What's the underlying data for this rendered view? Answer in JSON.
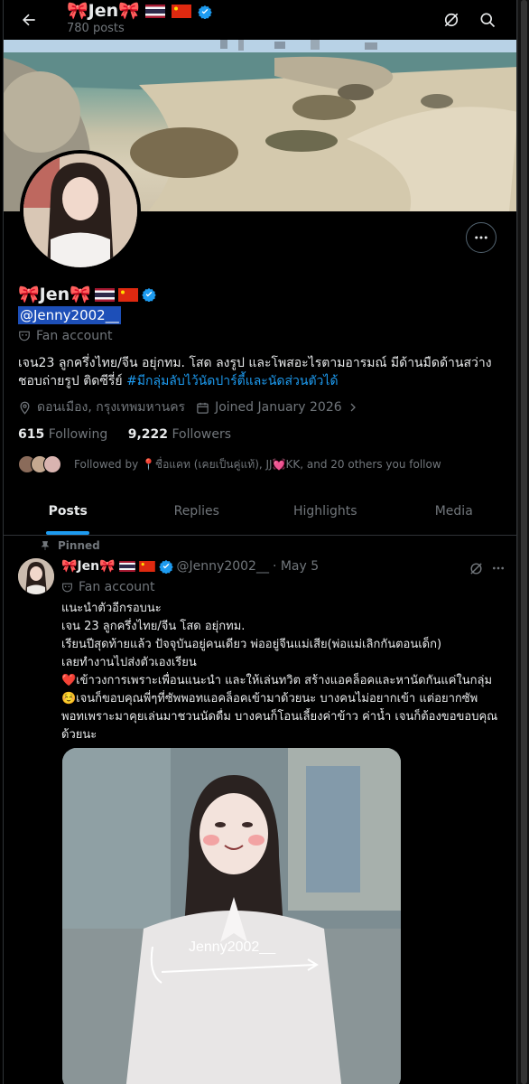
{
  "header": {
    "name": "🎀Jen🎀",
    "post_count": "780 posts"
  },
  "profile": {
    "name": "🎀Jen🎀",
    "handle": "@Jenny2002__",
    "category": "Fan account",
    "bio_text": "เจน23 ลูกครึ่งไทย/จีน อยุ่กทม. โสด ลงรูป และโพสอะไรตามอารมณ์ มีด้านมืดด้านสว่าง ชอบถ่ายรูป ติดซีรี่ย์ ",
    "bio_link": "#มีกลุ่มลับไว้นัดปาร์ตี้และนัดส่วนตัวได้",
    "location": "ดอนเมือง, กรุงเทพมหานคร",
    "joined": "Joined January 2026",
    "following_count": "615",
    "following_label": "Following",
    "followers_count": "9,222",
    "followers_label": "Followers",
    "followed_by": "Followed by 📍ชื่อแคท (เคยเป็นคู่แท้), JJ💓KK, and 20 others you follow"
  },
  "tabs": [
    {
      "label": "Posts"
    },
    {
      "label": "Replies"
    },
    {
      "label": "Highlights"
    },
    {
      "label": "Media"
    }
  ],
  "post": {
    "pinned_label": "Pinned",
    "name": "🎀Jen🎀",
    "handle": "@Jenny2002__",
    "date": "· May 5",
    "category": "Fan account",
    "lines": [
      "แนะนำตัวอีกรอบนะ",
      "เจน 23 ลูกครึ่งไทย/จีน โสด อยุ่กทม.",
      "เรียนปีสุดท้ายแล้ว ปัจจุบันอยู่คนเดียว พ่ออยู่จีนแม่เสีย(พ่อแม่เลิกกันตอนเด็ก)",
      "เลยทำงานไปส่งตัวเองเรียน",
      "❤️เข้าวงการเพราะเพื่อนแนะนำ  และให้เล่นทวิต สร้างแอคล็อคและหานัดกันแค่ในกลุ่ม",
      "☺️เจนก็ขอบคุณพี่ๆที่ซัพพอทแอคล็อคเข้ามาด้วยนะ  บางคนไม่อยากเข้า แต่อยากซัพ",
      "พอทเพราะมาคุยเล่นมาชวนนัดดื่ม บางคนก็โอนเลี้ยงค่าข้าว ค่าน้ำ เจนก็ต้องขอขอบคุณ",
      "ด้วยนะ"
    ],
    "watermark": "Jenny2002__"
  }
}
